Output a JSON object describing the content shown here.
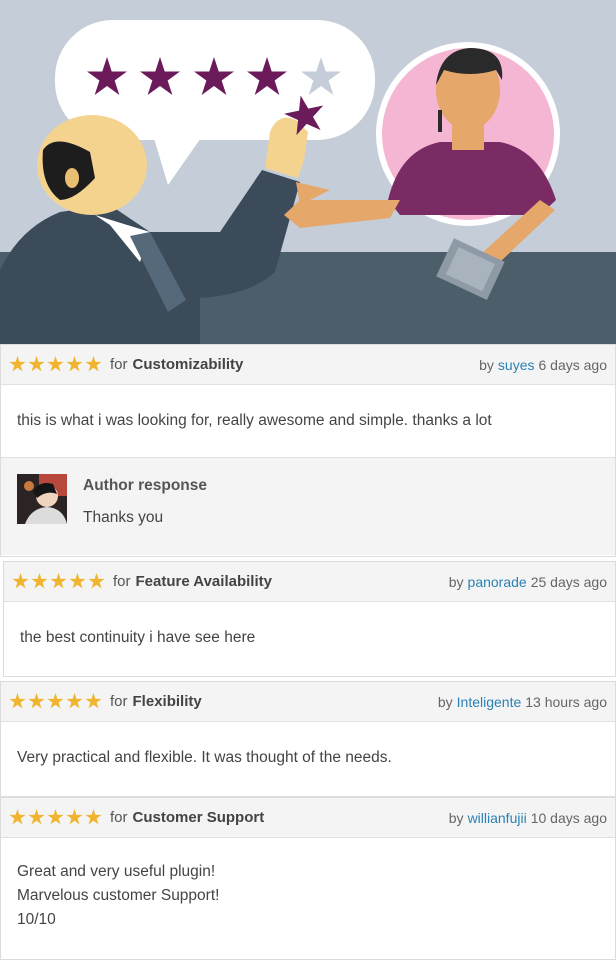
{
  "colors": {
    "star": "#f0b430",
    "link": "#2a81b4",
    "hero_bg": "#c5ced8",
    "hero_floor": "#4b5e6a",
    "accent_purple": "#6b1b5a"
  },
  "hero": {
    "rating": "4 of 5 stars, adding the fifth"
  },
  "reviews": [
    {
      "stars": 5,
      "for_word": "for",
      "category": "Customizability",
      "by_word": "by",
      "user": "suyes",
      "time": "6 days ago",
      "lines": [
        "this is what i was looking for, really awesome and simple. thanks a lot"
      ],
      "author_response": {
        "title": "Author response",
        "text": "Thanks you"
      }
    },
    {
      "stars": 5,
      "for_word": "for",
      "category": "Feature Availability",
      "by_word": "by",
      "user": "panorade",
      "time": "25 days ago",
      "lines": [
        "the best continuity i have see here"
      ]
    },
    {
      "stars": 5,
      "for_word": "for",
      "category": "Flexibility",
      "by_word": "by",
      "user": "Inteligente",
      "time": "13 hours ago",
      "lines": [
        "Very practical and flexible. It was thought of the needs."
      ]
    },
    {
      "stars": 5,
      "for_word": "for",
      "category": "Customer Support",
      "by_word": "by",
      "user": "willianfujii",
      "time": "10 days ago",
      "lines": [
        "Great and very useful plugin!",
        "Marvelous customer Support!",
        "10/10"
      ]
    }
  ]
}
